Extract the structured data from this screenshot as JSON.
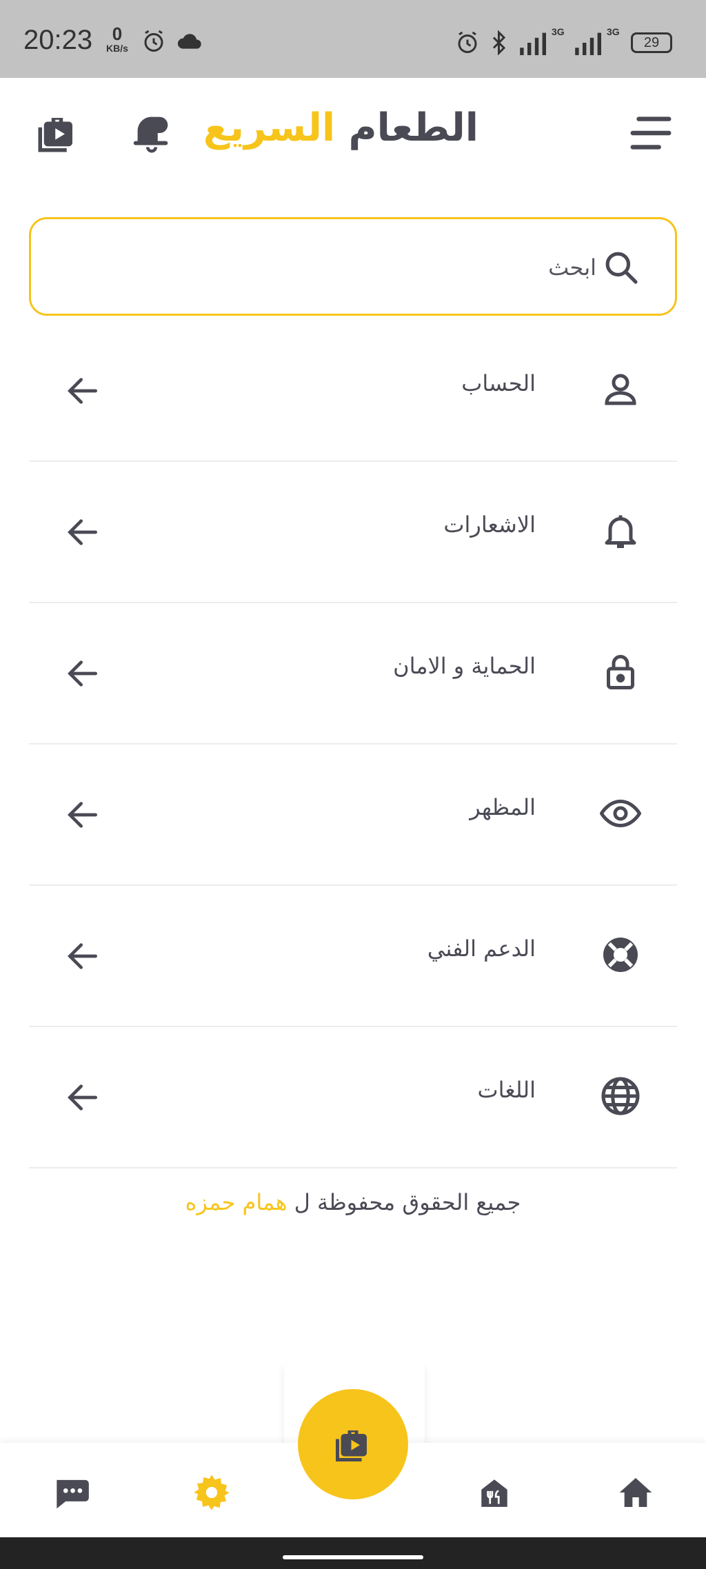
{
  "status_bar": {
    "time": "20:23",
    "net_speed_value": "0",
    "net_speed_unit": "KB/s",
    "network_1": "3G",
    "network_2": "3G",
    "battery": "29",
    "icons": [
      "alarm-icon",
      "cloud-icon",
      "alarm-icon",
      "bluetooth-icon",
      "signal-icon",
      "signal-icon",
      "battery-icon"
    ]
  },
  "header": {
    "title_part1": "الطعام",
    "title_part2": "السريع",
    "menu_icon": "hamburger-menu-icon",
    "notification_icon": "bell-icon",
    "store_icon": "shopping-bag-icon"
  },
  "search": {
    "placeholder": "ابحث",
    "icon": "search-icon"
  },
  "menu": {
    "items": [
      {
        "label": "الحساب",
        "icon": "user-icon"
      },
      {
        "label": "الاشعارات",
        "icon": "bell-icon"
      },
      {
        "label": "الحماية و الامان",
        "icon": "lock-icon"
      },
      {
        "label": "المظهر",
        "icon": "eye-icon"
      },
      {
        "label": "الدعم الفني",
        "icon": "lifebuoy-icon"
      },
      {
        "label": "اللغات",
        "icon": "globe-icon"
      }
    ],
    "arrow_icon": "arrow-left-icon"
  },
  "footer": {
    "rights_text": "جميع الحقوق محفوظة ل",
    "owner": "همام حمزه"
  },
  "bottom_nav": {
    "items": [
      "chat-icon",
      "settings-icon",
      "shopping-bag-icon",
      "restaurant-icon",
      "home-icon"
    ],
    "active": "settings-icon"
  },
  "colors": {
    "accent": "#f7c41b",
    "text": "#4a4a55",
    "divider": "#ececec"
  }
}
